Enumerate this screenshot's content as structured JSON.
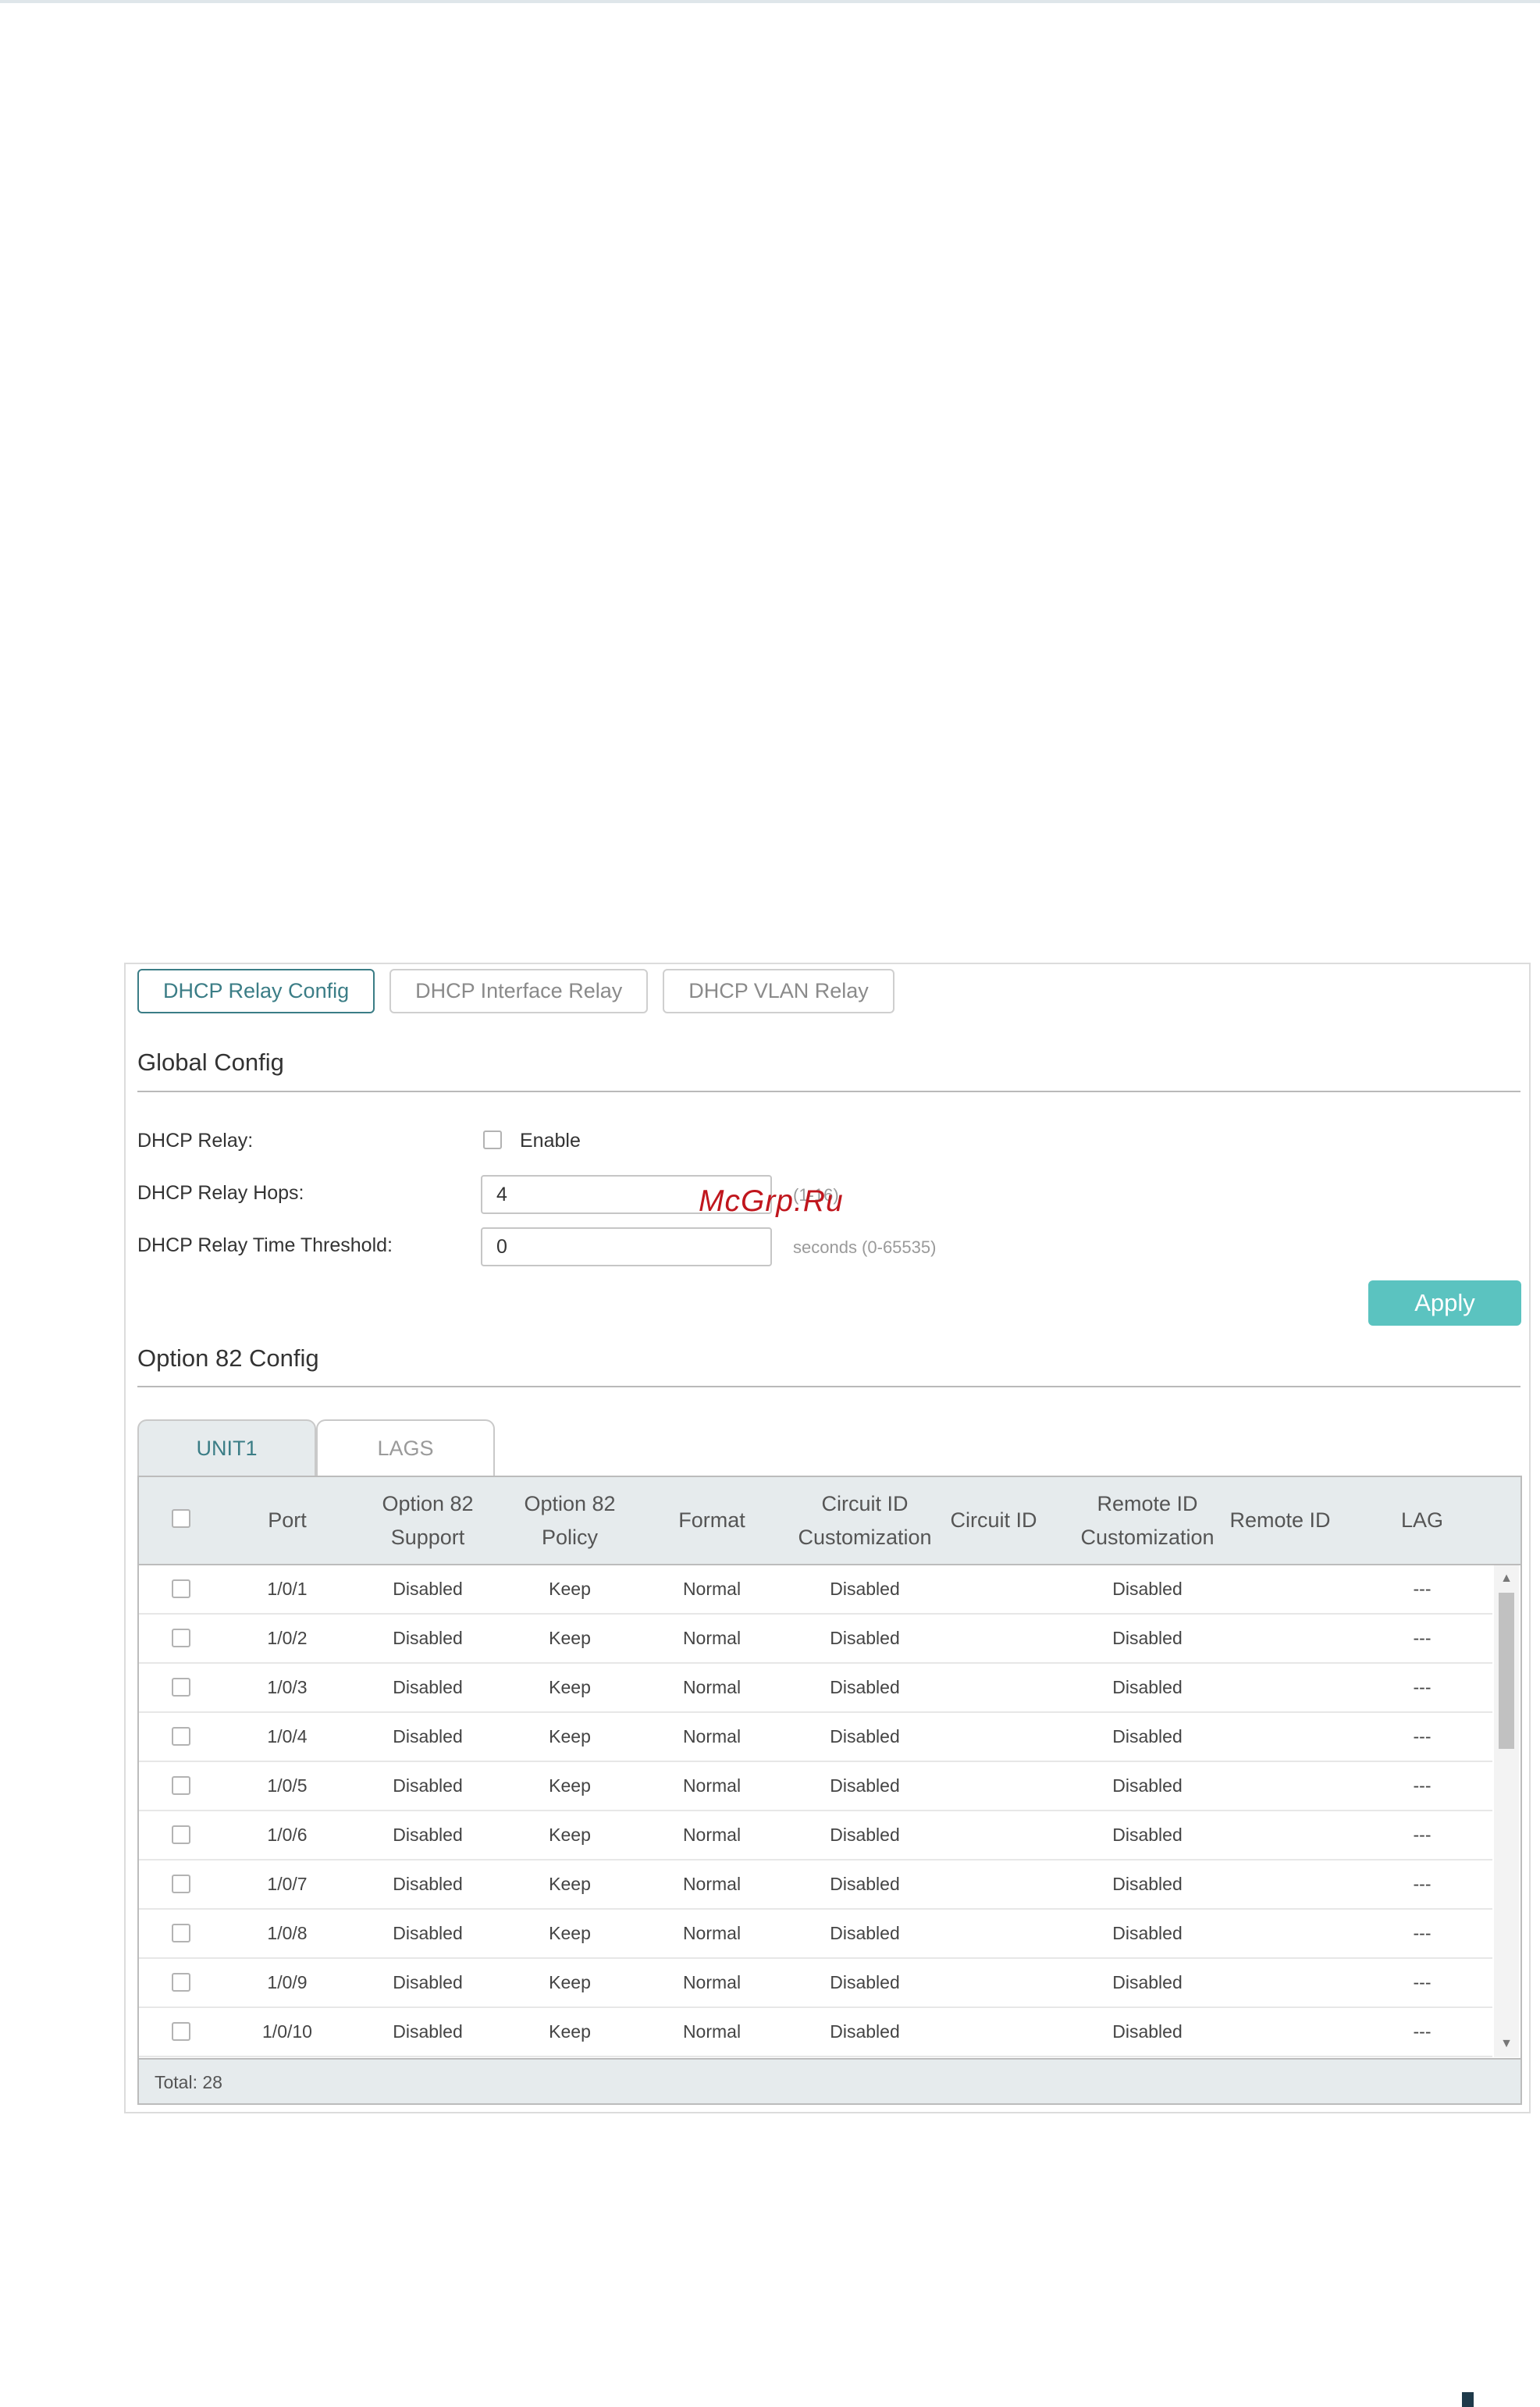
{
  "tabs": [
    {
      "label": "DHCP Relay Config",
      "active": true
    },
    {
      "label": "DHCP Interface Relay",
      "active": false
    },
    {
      "label": "DHCP VLAN Relay",
      "active": false
    }
  ],
  "global_config": {
    "title": "Global Config",
    "dhcp_relay_label": "DHCP Relay:",
    "enable_label": "Enable",
    "hops_label": "DHCP Relay Hops:",
    "hops_value": "4",
    "hops_hint": "(1-16)",
    "threshold_label": "DHCP Relay Time Threshold:",
    "threshold_value": "0",
    "threshold_hint": "seconds (0-65535)",
    "apply_label": "Apply"
  },
  "option82": {
    "title": "Option 82 Config",
    "unit_tabs": [
      {
        "label": "UNIT1",
        "active": true
      },
      {
        "label": "LAGS",
        "active": false
      }
    ],
    "headers": [
      "Port",
      "Option 82 Support",
      "Option 82 Policy",
      "Format",
      "Circuit ID Customization",
      "Circuit ID",
      "Remote ID Customization",
      "Remote ID",
      "LAG"
    ],
    "rows": [
      [
        "1/0/1",
        "Disabled",
        "Keep",
        "Normal",
        "Disabled",
        "",
        "Disabled",
        "",
        "---"
      ],
      [
        "1/0/2",
        "Disabled",
        "Keep",
        "Normal",
        "Disabled",
        "",
        "Disabled",
        "",
        "---"
      ],
      [
        "1/0/3",
        "Disabled",
        "Keep",
        "Normal",
        "Disabled",
        "",
        "Disabled",
        "",
        "---"
      ],
      [
        "1/0/4",
        "Disabled",
        "Keep",
        "Normal",
        "Disabled",
        "",
        "Disabled",
        "",
        "---"
      ],
      [
        "1/0/5",
        "Disabled",
        "Keep",
        "Normal",
        "Disabled",
        "",
        "Disabled",
        "",
        "---"
      ],
      [
        "1/0/6",
        "Disabled",
        "Keep",
        "Normal",
        "Disabled",
        "",
        "Disabled",
        "",
        "---"
      ],
      [
        "1/0/7",
        "Disabled",
        "Keep",
        "Normal",
        "Disabled",
        "",
        "Disabled",
        "",
        "---"
      ],
      [
        "1/0/8",
        "Disabled",
        "Keep",
        "Normal",
        "Disabled",
        "",
        "Disabled",
        "",
        "---"
      ],
      [
        "1/0/9",
        "Disabled",
        "Keep",
        "Normal",
        "Disabled",
        "",
        "Disabled",
        "",
        "---"
      ],
      [
        "1/0/10",
        "Disabled",
        "Keep",
        "Normal",
        "Disabled",
        "",
        "Disabled",
        "",
        "---"
      ]
    ],
    "total_text": "Total: 28"
  },
  "watermark": "McGrp.Ru",
  "colors": {
    "accent": "#3b7d86",
    "apply_button": "#5bc3c0",
    "header_bg": "#e6ebed",
    "watermark": "#c0161d"
  },
  "icons": {
    "scroll_up": "triangle-up-icon",
    "scroll_down": "triangle-down-icon"
  }
}
